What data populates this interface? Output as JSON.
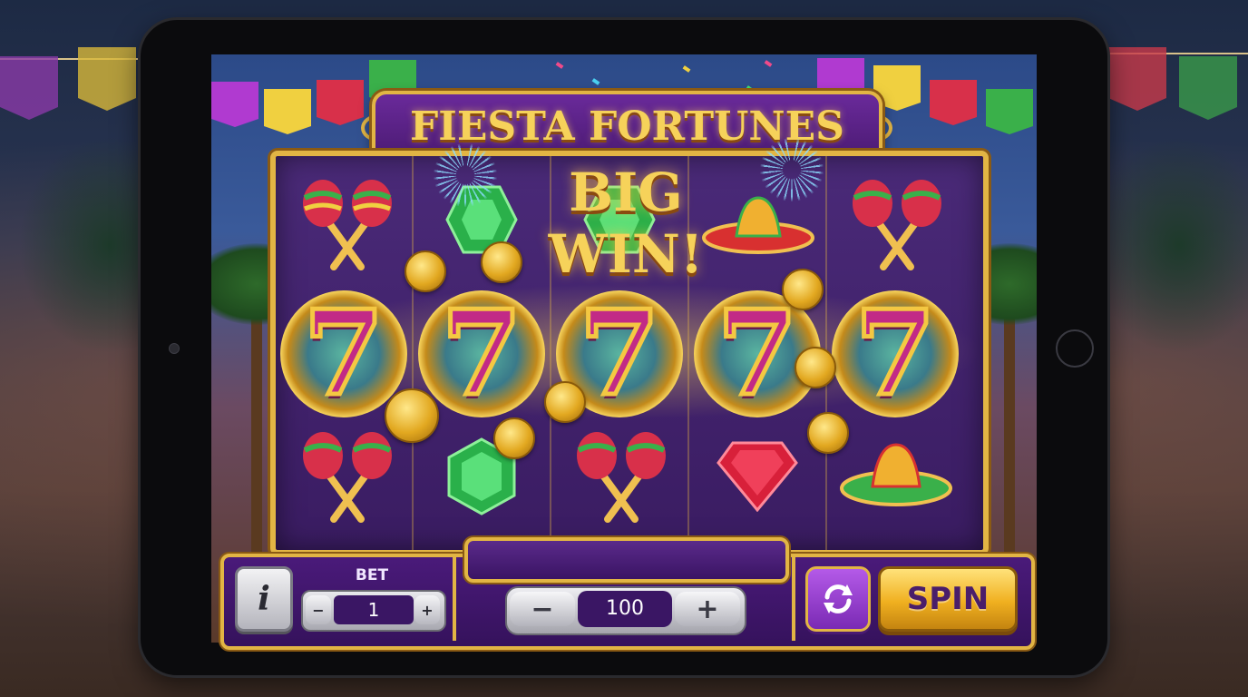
{
  "game": {
    "title": "FIESTA FORTUNES",
    "win_banner": "BIG WIN!"
  },
  "reels": {
    "columns": [
      {
        "top": "maracas",
        "middle": "seven",
        "bottom": "maracas"
      },
      {
        "top": "green-gem",
        "middle": "seven",
        "bottom": "green-gem"
      },
      {
        "top": "green-gem",
        "middle": "seven",
        "bottom": "maracas"
      },
      {
        "top": "sombrero",
        "middle": "seven",
        "bottom": "red-gem"
      },
      {
        "top": "maracas",
        "middle": "seven",
        "bottom": "sombrero"
      }
    ],
    "seven_glyph": "7"
  },
  "controls": {
    "info_icon": "i",
    "bet_label": "BET",
    "bet_value": "1",
    "bet_minus": "−",
    "bet_plus": "+",
    "amount_value": "100",
    "amount_minus": "−",
    "amount_plus": "+",
    "autospin_icon": "refresh-icon",
    "spin_label": "SPIN"
  },
  "colors": {
    "gold": "#e2b544",
    "purple": "#4a1a7a",
    "magenta": "#c22a86"
  }
}
